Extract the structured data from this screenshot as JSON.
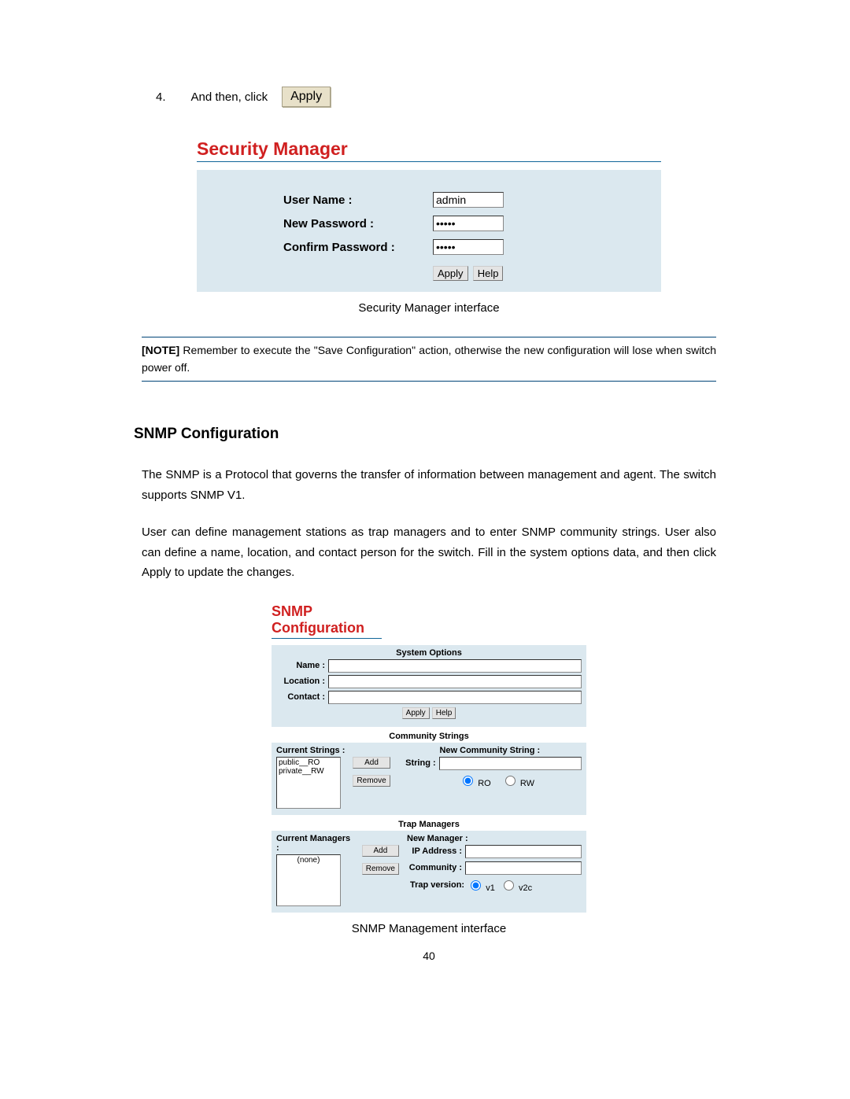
{
  "step": {
    "num": "4.",
    "text_before": "And then, click",
    "apply_btn": "Apply"
  },
  "security_manager": {
    "title": "Security Manager",
    "labels": {
      "username": "User Name :",
      "newpass": "New Password :",
      "confirmpass": "Confirm Password :"
    },
    "values": {
      "username": "admin",
      "newpass": "•••••",
      "confirmpass": "•••••"
    },
    "buttons": {
      "apply": "Apply",
      "help": "Help"
    },
    "caption": "Security Manager interface"
  },
  "note": {
    "label": "[NOTE]",
    "text": " Remember to execute the \"Save Configuration\" action, otherwise the new configuration will lose when switch power off."
  },
  "snmp_heading": "SNMP Configuration",
  "para1": "The SNMP is a Protocol that governs the transfer of information between management and agent. The switch supports SNMP V1.",
  "para2": "User can define management stations as trap managers and to enter SNMP community strings. User also can define a name, location, and contact person for the switch. Fill in the system options data, and then click Apply to update the changes.",
  "snmp_panel": {
    "title": "SNMP Configuration",
    "system_options": {
      "title": "System Options",
      "name_label": "Name :",
      "location_label": "Location :",
      "contact_label": "Contact :",
      "apply": "Apply",
      "help": "Help"
    },
    "community": {
      "title": "Community Strings",
      "current_label": "Current Strings :",
      "list": [
        "public__RO",
        "private__RW"
      ],
      "add": "Add",
      "remove": "Remove",
      "new_label": "New Community String :",
      "string_label": "String :",
      "ro": "RO",
      "rw": "RW"
    },
    "trap": {
      "title": "Trap Managers",
      "current_label": "Current Managers :",
      "list": "(none)",
      "add": "Add",
      "remove": "Remove",
      "new_label": "New Manager :",
      "ip_label": "IP Address :",
      "community_label": "Community :",
      "trapv_label": "Trap version:",
      "v1": "v1",
      "v2c": "v2c"
    },
    "caption": "SNMP Management interface"
  },
  "page_number": "40"
}
